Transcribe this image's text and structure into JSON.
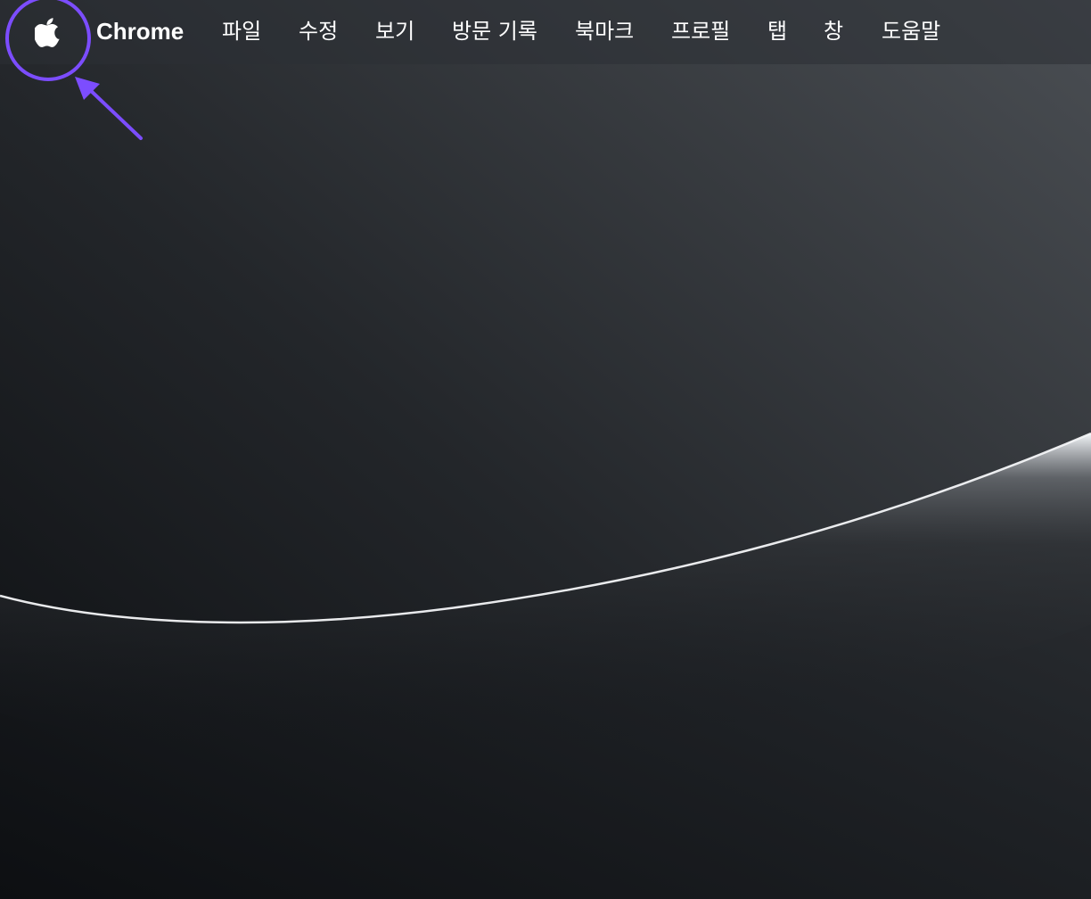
{
  "menubar": {
    "apple_icon": "apple-logo-icon",
    "app_name": "Chrome",
    "items": [
      {
        "id": "file",
        "label": "파일"
      },
      {
        "id": "edit",
        "label": "수정"
      },
      {
        "id": "view",
        "label": "보기"
      },
      {
        "id": "history",
        "label": "방문 기록"
      },
      {
        "id": "bookmarks",
        "label": "북마크"
      },
      {
        "id": "profiles",
        "label": "프로필"
      },
      {
        "id": "tab",
        "label": "탭"
      },
      {
        "id": "window",
        "label": "창"
      },
      {
        "id": "help",
        "label": "도움말"
      }
    ]
  },
  "annotation": {
    "highlight_color": "#7c4dff",
    "marks": [
      "highlight-circle",
      "arrow"
    ]
  },
  "colors": {
    "menubar_text": "#ffffff",
    "background_dark": "#0e1013",
    "background_light": "#4a4e53",
    "wave_glow": "#f2f5f8"
  }
}
